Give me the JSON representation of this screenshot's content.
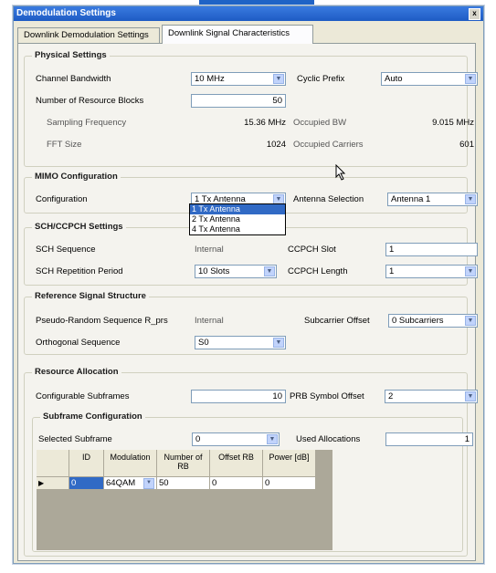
{
  "window": {
    "title": "Demodulation Settings",
    "close_glyph": "x"
  },
  "tabs": [
    "Downlink Demodulation Settings",
    "Downlink Signal Characteristics"
  ],
  "physical": {
    "title": "Physical Settings",
    "channel_bw_label": "Channel Bandwidth",
    "channel_bw_value": "10 MHz",
    "cyclic_prefix_label": "Cyclic Prefix",
    "cyclic_prefix_value": "Auto",
    "rb_label": "Number of Resource Blocks",
    "rb_value": "50",
    "sampling_label": "Sampling Frequency",
    "sampling_value": "15.36 MHz",
    "occupied_bw_label": "Occupied BW",
    "occupied_bw_value": "9.015 MHz",
    "fft_label": "FFT Size",
    "fft_value": "1024",
    "occupied_carriers_label": "Occupied Carriers",
    "occupied_carriers_value": "601"
  },
  "mimo": {
    "title": "MIMO Configuration",
    "config_label": "Configuration",
    "config_value": "1 Tx Antenna",
    "antenna_label": "Antenna Selection",
    "antenna_value": "Antenna 1",
    "options": [
      "1 Tx Antenna",
      "2 Tx Antenna",
      "4 Tx Antenna"
    ]
  },
  "sch": {
    "title": "SCH/CCPCH Settings",
    "seq_label": "SCH Sequence",
    "seq_value": "Internal",
    "slot_label": "CCPCH Slot",
    "slot_value": "1",
    "period_label": "SCH Repetition Period",
    "period_value": "10 Slots",
    "length_label": "CCPCH Length",
    "length_value": "1"
  },
  "ref": {
    "title": "Reference Signal Structure",
    "pn_label": "Pseudo-Random Sequence R_prs",
    "pn_value": "Internal",
    "offset_label": "Subcarrier Offset",
    "offset_value": "0 Subcarriers",
    "ortho_label": "Orthogonal Sequence",
    "ortho_value": "S0"
  },
  "resource": {
    "title": "Resource Allocation",
    "subframes_label": "Configurable Subframes",
    "subframes_value": "10",
    "prb_label": "PRB Symbol Offset",
    "prb_value": "2"
  },
  "subframe": {
    "title": "Subframe Configuration",
    "selected_label": "Selected Subframe",
    "selected_value": "0",
    "used_label": "Used Allocations",
    "used_value": "1"
  },
  "table": {
    "headers": [
      "ID",
      "Modulation",
      "Number of RB",
      "Offset RB",
      "Power [dB]"
    ],
    "rows": [
      {
        "marker": "▶",
        "id": "0",
        "modulation": "64QAM",
        "num_rb": "50",
        "offset": "0",
        "power": "0"
      }
    ]
  },
  "colors": {
    "title_bar": "#1e5bc4",
    "selection": "#316ac5",
    "panel": "#f4f3ee"
  }
}
